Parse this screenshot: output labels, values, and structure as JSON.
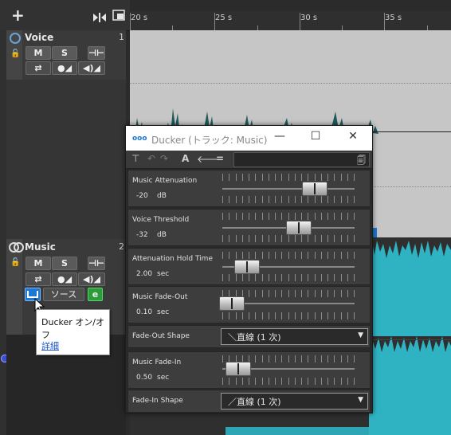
{
  "toolbar": {
    "add_icon": "+",
    "fit_icon": "▸◂",
    "layout_icon": "⧉"
  },
  "ruler": {
    "labels": [
      "20 s",
      "25 s",
      "30 s",
      "35 s"
    ]
  },
  "tracks": [
    {
      "name": "Voice",
      "number": "1",
      "mute_label": "M",
      "solo_label": "S"
    },
    {
      "name": "Music",
      "number": "2",
      "mute_label": "M",
      "solo_label": "S",
      "source_label": "ソース",
      "edit_label": "e"
    }
  ],
  "tooltip": {
    "title": "Ducker オン/オフ",
    "link": "詳細"
  },
  "plugin": {
    "title": "Ducker (トラック: Music)",
    "params": [
      {
        "name": "Music Attenuation",
        "value": "-20",
        "unit": "dB",
        "level": 0.72
      },
      {
        "name": "Voice Threshold",
        "value": "-32",
        "unit": "dB",
        "level": 0.58
      },
      {
        "name": "Attenuation Hold Time",
        "value": "2.00",
        "unit": "sec",
        "level": 0.14
      },
      {
        "name": "Music Fade-Out",
        "value": "0.10",
        "unit": "sec",
        "level": 0.01
      },
      {
        "name": "Music Fade-In",
        "value": "0.50",
        "unit": "sec",
        "level": 0.06
      }
    ],
    "fade_out_shape": {
      "label": "Fade-Out Shape",
      "value": "＼直線 (1 次)"
    },
    "fade_in_shape": {
      "label": "Fade-In Shape",
      "value": "／直線 (1 次)"
    }
  },
  "colors": {
    "accent": "#1e78d2",
    "waveform_voice": "#1f5a5a",
    "waveform_music": "#2fb3c3",
    "edit_green": "#2e9b3a"
  }
}
